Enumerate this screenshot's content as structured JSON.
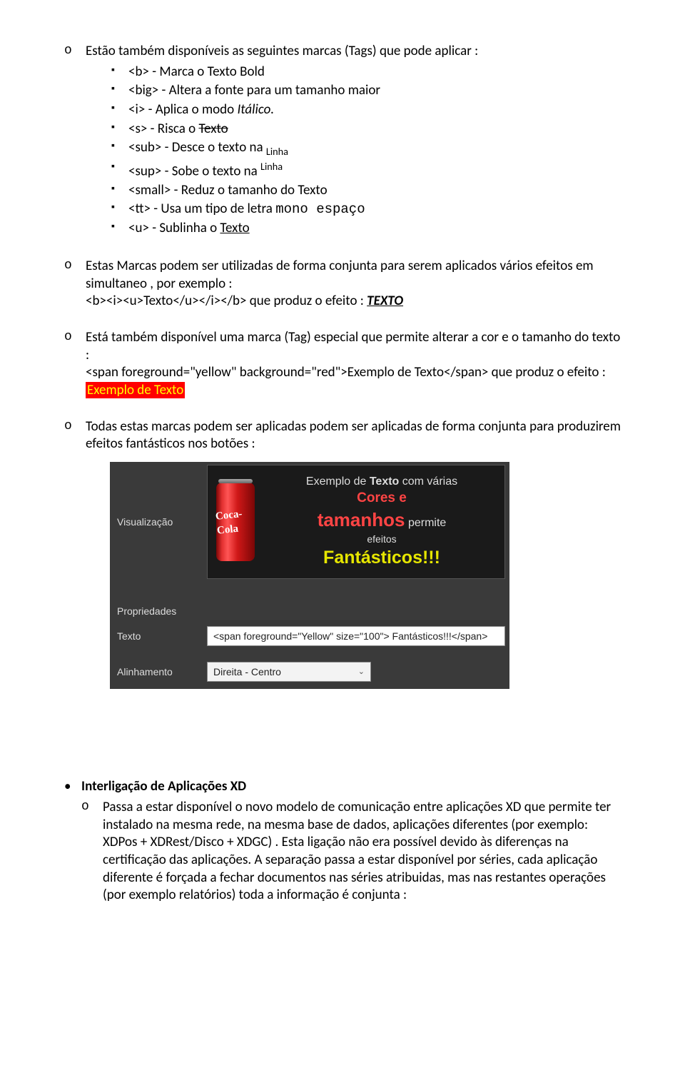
{
  "section1": {
    "intro": "Estão também disponíveis as seguintes marcas (Tags) que pode aplicar :",
    "items": [
      {
        "tag": "<b>",
        "text": " - Marca o Texto Bold"
      },
      {
        "tag": "<big>",
        "text": " - Altera a fonte para um tamanho maior"
      },
      {
        "tag": "<i>",
        "text": " - Aplica o modo "
      },
      {
        "tag": "<s>",
        "text": " - Risca o "
      },
      {
        "tag": "<sub>",
        "text": " - Desce o texto na "
      },
      {
        "tag": "<sup>",
        "text": " - Sobe o texto na "
      },
      {
        "tag": "<small>",
        "text": " - Reduz o tamanho do Texto"
      },
      {
        "tag": "<tt>",
        "text": " - Usa um tipo de letra "
      },
      {
        "tag": "<u>",
        "text": " - Sublinha o "
      }
    ],
    "italico": "Itálico.",
    "texto_strike": "Texto",
    "linha": "Linha",
    "mono_espaco": "mono espaço",
    "texto_under": "Texto"
  },
  "section2": {
    "line1": "Estas Marcas podem ser utilizadas de forma conjunta para serem aplicados vários efeitos em simultaneo , por exemplo :",
    "code": "<b><i><u>Texto</u></i></b> que produz o efeito : ",
    "efeito": "TEXTO"
  },
  "section3": {
    "line1": "Está também disponível uma marca (Tag) especial que permite alterar a cor e o tamanho do texto :",
    "code": "<span foreground=\"yellow\" background=\"red\">Exemplo de Texto</span> que produz o efeito : ",
    "exemplo": "Exemplo de Texto"
  },
  "section4": {
    "line": "Todas estas marcas podem ser aplicadas podem ser aplicadas de forma conjunta para produzirem efeitos fantásticos nos botões :"
  },
  "screenshot": {
    "vis_label": "Visualização",
    "preview_line1_a": "Exemplo de ",
    "preview_line1_b": "Texto",
    "preview_line1_c": " com várias",
    "preview_cores": "Cores e",
    "preview_tam": "tamanhos",
    "preview_permite": " permite",
    "preview_efeitos": "efeitos",
    "preview_fant": "Fantásticos!!!",
    "coke": "Coca-Cola",
    "prop_label": "Propriedades",
    "texto_label": "Texto",
    "texto_value": "<span foreground=\"Yellow\" size=\"100\"> Fantásticos!!!</span>",
    "alin_label": "Alinhamento",
    "alin_value": "Direita - Centro"
  },
  "section5": {
    "title": "Interligação de Aplicações XD",
    "body": "Passa a estar disponível o novo modelo de comunicação entre aplicações XD que permite ter instalado na mesma rede, na mesma base de dados, aplicações diferentes (por exemplo: XDPos + XDRest/Disco + XDGC) . Esta ligação não era possível devido às diferenças na certificação das aplicações. A separação passa a estar disponível por séries, cada aplicação diferente é forçada a fechar documentos nas séries atribuidas, mas nas restantes operações (por exemplo relatórios) toda a informação é conjunta :"
  }
}
